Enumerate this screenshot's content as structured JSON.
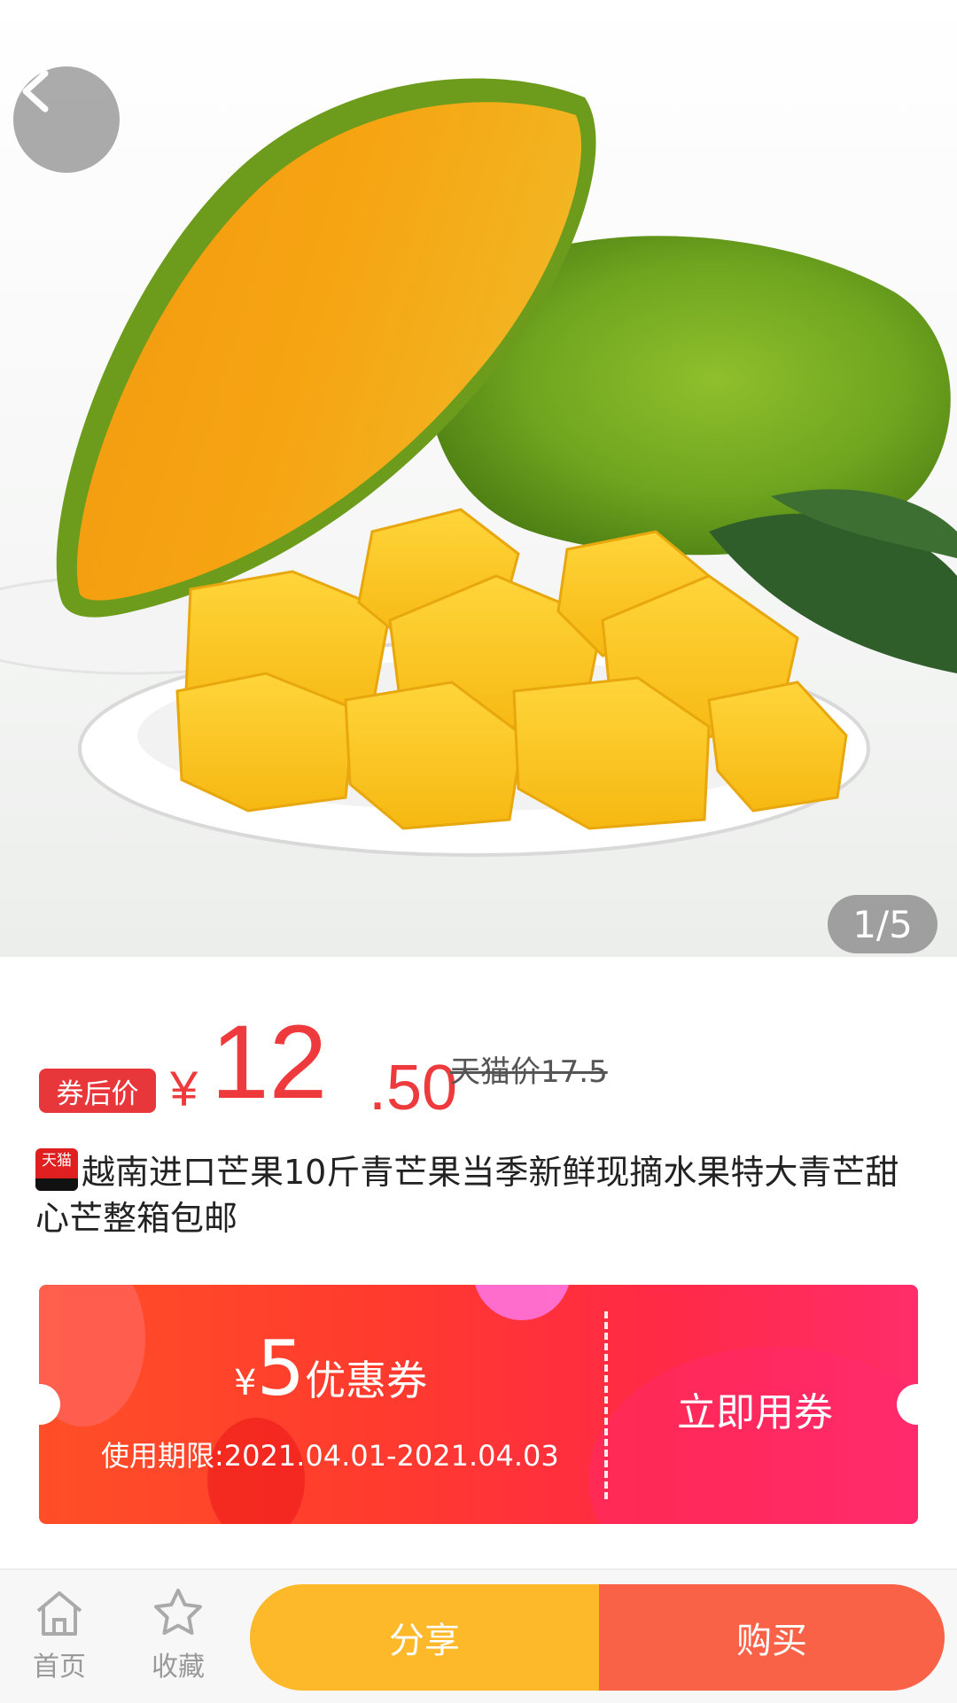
{
  "gallery": {
    "counter": "1/5",
    "image_subject": "mango-photo"
  },
  "price": {
    "tag": "券后价",
    "currency": "¥",
    "integer": "12",
    "decimal": ".50",
    "original": "天猫价17.5"
  },
  "product": {
    "badge": "天猫",
    "title": "越南进口芒果10斤青芒果当季新鲜现摘水果特大青芒甜心芒整箱包邮"
  },
  "coupon": {
    "currency": "¥",
    "amount": "5",
    "label": "优惠券",
    "validity": "使用期限:2021.04.01-2021.04.03",
    "action": "立即用券"
  },
  "bottom_nav": {
    "home": "首页",
    "favorite": "收藏",
    "share": "分享",
    "buy": "购买"
  },
  "colors": {
    "price_red": "#ee3a3c",
    "share_yellow": "#fdb92a",
    "buy_orange": "#fa6247"
  }
}
